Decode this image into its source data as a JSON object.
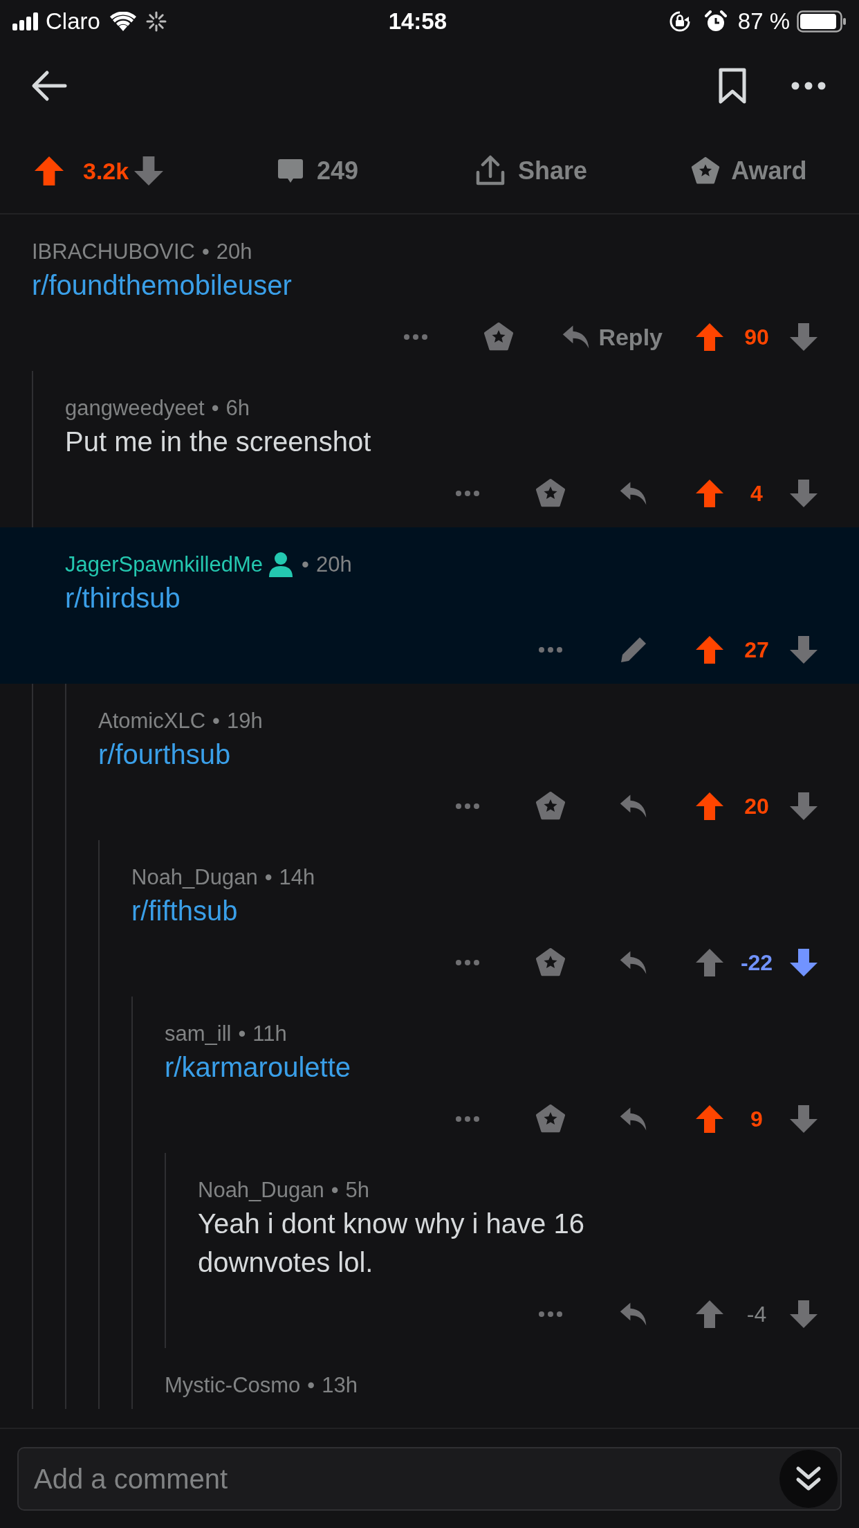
{
  "status_bar": {
    "carrier": "Claro",
    "time": "14:58",
    "battery": "87 %"
  },
  "post_bar": {
    "score": "3.2k",
    "upvoted": true,
    "downvoted": false,
    "comments": "249",
    "share": "Share",
    "award": "Award"
  },
  "comments": [
    {
      "author": "IBRACHUBOVIC",
      "separator": "•",
      "time": "20h",
      "own": false,
      "highlighted": false,
      "body": {
        "kind": "link",
        "text": "r/foundthemobileuser"
      },
      "actions": [
        {
          "kind": "more"
        },
        {
          "kind": "award"
        },
        {
          "kind": "reply",
          "label": "Reply"
        }
      ],
      "score": "90",
      "upvoted": true,
      "downvoted": false,
      "children": [
        {
          "author": "gangweedyeet",
          "separator": "•",
          "time": "6h",
          "own": false,
          "highlighted": false,
          "body": {
            "kind": "text",
            "text": "Put me in the screenshot"
          },
          "actions": [
            {
              "kind": "more"
            },
            {
              "kind": "award"
            },
            {
              "kind": "reply"
            }
          ],
          "score": "4",
          "upvoted": true,
          "downvoted": false
        },
        {
          "author": "JagerSpawnkilledMe",
          "separator": "•",
          "time": "20h",
          "own": true,
          "highlighted": true,
          "body": {
            "kind": "link",
            "text": "r/thirdsub"
          },
          "actions": [
            {
              "kind": "more"
            },
            {
              "kind": "edit"
            }
          ],
          "score": "27",
          "upvoted": true,
          "downvoted": false,
          "children": [
            {
              "author": "AtomicXLC",
              "separator": "•",
              "time": "19h",
              "own": false,
              "highlighted": false,
              "body": {
                "kind": "link",
                "text": "r/fourthsub"
              },
              "actions": [
                {
                  "kind": "more"
                },
                {
                  "kind": "award"
                },
                {
                  "kind": "reply"
                }
              ],
              "score": "20",
              "upvoted": true,
              "downvoted": false,
              "children": [
                {
                  "author": "Noah_Dugan",
                  "separator": "•",
                  "time": "14h",
                  "own": false,
                  "highlighted": false,
                  "body": {
                    "kind": "link",
                    "text": "r/fifthsub"
                  },
                  "actions": [
                    {
                      "kind": "more"
                    },
                    {
                      "kind": "award"
                    },
                    {
                      "kind": "reply"
                    }
                  ],
                  "score": "-22",
                  "upvoted": false,
                  "downvoted": true,
                  "children": [
                    {
                      "author": "sam_ill",
                      "separator": "•",
                      "time": "11h",
                      "own": false,
                      "highlighted": false,
                      "body": {
                        "kind": "link",
                        "text": "r/karmaroulette"
                      },
                      "actions": [
                        {
                          "kind": "more"
                        },
                        {
                          "kind": "award"
                        },
                        {
                          "kind": "reply"
                        }
                      ],
                      "score": "9",
                      "upvoted": true,
                      "downvoted": false,
                      "children": [
                        {
                          "author": "Noah_Dugan",
                          "separator": "•",
                          "time": "5h",
                          "own": false,
                          "highlighted": false,
                          "body": {
                            "kind": "text",
                            "text": "Yeah i dont know why i have 16 downvotes lol."
                          },
                          "actions": [
                            {
                              "kind": "more"
                            },
                            {
                              "kind": "reply"
                            }
                          ],
                          "score": "-4",
                          "upvoted": false,
                          "downvoted": false
                        }
                      ]
                    },
                    {
                      "author": "Mystic-Cosmo",
                      "separator": "•",
                      "time": "13h",
                      "own": false,
                      "highlighted": false
                    }
                  ]
                }
              ]
            }
          ]
        }
      ]
    }
  ],
  "composer": {
    "placeholder": "Add a comment"
  }
}
